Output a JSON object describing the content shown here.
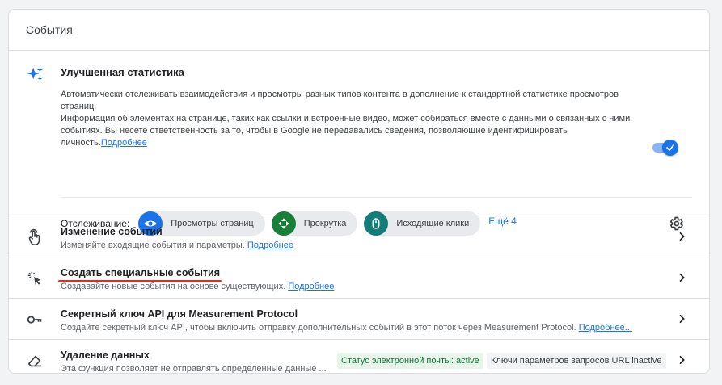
{
  "card": {
    "title": "События"
  },
  "enhanced": {
    "title": "Улучшенная статистика",
    "desc1": "Автоматически отслеживать взаимодействия и просмотры разных типов контента в дополнение к стандартной статистике просмотров страниц.",
    "desc2": "Информация об элементах на странице, таких как ссылки и встроенные видео, может собираться вместе с данными о связанных с ними событиях. Вы несете ответственность за то, чтобы в Google не передавались сведения, позволяющие идентифицировать личность.",
    "learn_more": "Подробнее",
    "toggle_on": true,
    "tracking_label": "Отслеживание:",
    "chips": [
      {
        "label": "Просмотры страниц",
        "icon": "eye-icon",
        "color": "#1a73e8"
      },
      {
        "label": "Прокрутка",
        "icon": "scroll-icon",
        "color": "#188038"
      },
      {
        "label": "Исходящие клики",
        "icon": "mouse-icon",
        "color": "#137d7a"
      }
    ],
    "more": "Ещё 4"
  },
  "rows": [
    {
      "title": "Изменение событий",
      "desc": "Изменяйте входящие события и параметры. ",
      "link": "Подробнее",
      "icon": "touch-icon"
    },
    {
      "title": "Создать специальные события",
      "desc": "Создавайте новые события на основе существующих. ",
      "link": "Подробнее",
      "icon": "click-sparkle-icon"
    },
    {
      "title": "Секретный ключ API для Measurement Protocol",
      "desc": "Создайте секретный ключ API, чтобы включить отправку дополнительных событий в этот поток через Measurement Protocol. ",
      "link": "Подробнее...",
      "icon": "key-icon"
    },
    {
      "title": "Удаление данных",
      "desc": "Эта функция позволяет не отправлять определенные данные ...",
      "badge_email": "Статус электронной почты: active",
      "badge_url": "Ключи параметров запросов URL inactive",
      "icon": "eraser-icon"
    }
  ]
}
